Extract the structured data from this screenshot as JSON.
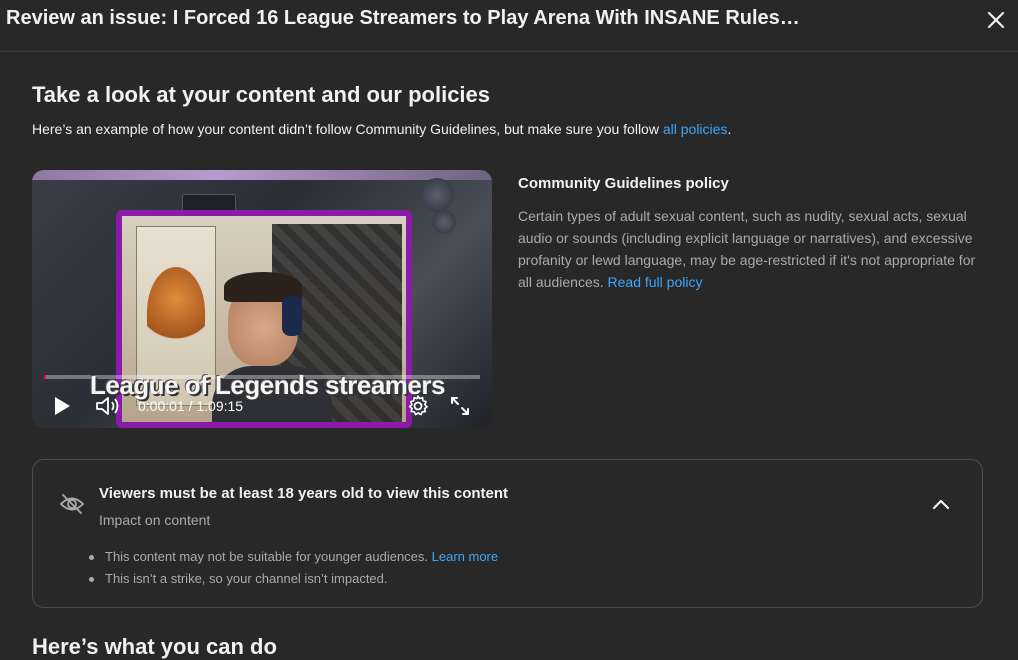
{
  "header": {
    "title": "Review an issue: I Forced 16 League Streamers to Play Arena With INSANE Rules…",
    "close_icon": "close-icon"
  },
  "section": {
    "title": "Take a look at your content and our policies",
    "intro_prefix": "Here’s an example of how your content didn’t follow Community Guidelines, but make sure you follow ",
    "intro_link": "all policies",
    "intro_suffix": "."
  },
  "video": {
    "caption": "League of Legends streamers",
    "time": "0:00:01 / 1:09:15",
    "progress_fraction": 0.0002,
    "icons": [
      "play-icon",
      "volume-icon",
      "settings-gear-icon",
      "fullscreen-icon"
    ]
  },
  "policy": {
    "title": "Community Guidelines policy",
    "text": "Certain types of adult sexual content, such as nudity, sexual acts, sexual audio or sounds (including explicit language or narratives), and excessive profanity or lewd language, may be age-restricted if it's not appropriate for all audiences. ",
    "link": "Read full policy"
  },
  "impact": {
    "title": "Viewers must be at least 18 years old to view this content",
    "subtitle": "Impact on content",
    "bullet1_text": "This content may not be suitable for younger audiences. ",
    "bullet1_link": "Learn more",
    "bullet2_text": "This isn’t a strike, so your channel isn’t impacted.",
    "icon": "eye-off-icon",
    "toggle_icon": "chevron-up-icon"
  },
  "next_section": {
    "title": "Here’s what you can do"
  },
  "colors": {
    "background": "#282828",
    "link": "#3ea6ff",
    "text_primary": "#f1f1f1",
    "text_secondary": "#aaaaaa",
    "webcam_border": "#8a1aa8"
  }
}
